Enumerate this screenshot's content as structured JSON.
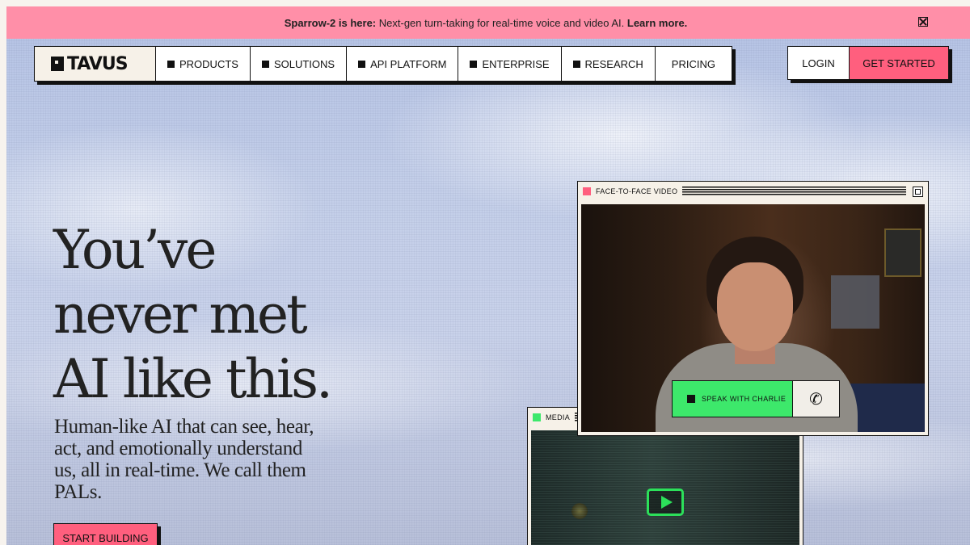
{
  "banner": {
    "bold": "Sparrow-2 is here:",
    "text": "Next-gen turn-taking for real-time voice and video AI.",
    "link": "Learn more."
  },
  "nav": {
    "logo": "TAVUS",
    "items": [
      "PRODUCTS",
      "SOLUTIONS",
      "API PLATFORM",
      "ENTERPRISE",
      "RESEARCH"
    ],
    "pricing": "PRICING",
    "login": "LOGIN",
    "get_started": "GET STARTED"
  },
  "hero": {
    "title_lines": [
      "You’ve",
      "never met",
      "AI like this."
    ],
    "subtitle": "Human-like AI that can see, hear, act, and emotionally understand us, all in real-time. We call them PALs.",
    "cta": "START BUILDING"
  },
  "video_window": {
    "title": "FACE-TO-FACE VIDEO",
    "speak_button": "SPEAK WITH CHARLIE",
    "call_icon": "phone-icon"
  },
  "media_window": {
    "title": "MEDIA",
    "play_icon": "play-icon"
  },
  "colors": {
    "banner": "#ff8fa8",
    "accent": "#ff5f7e",
    "green": "#3de86b"
  }
}
